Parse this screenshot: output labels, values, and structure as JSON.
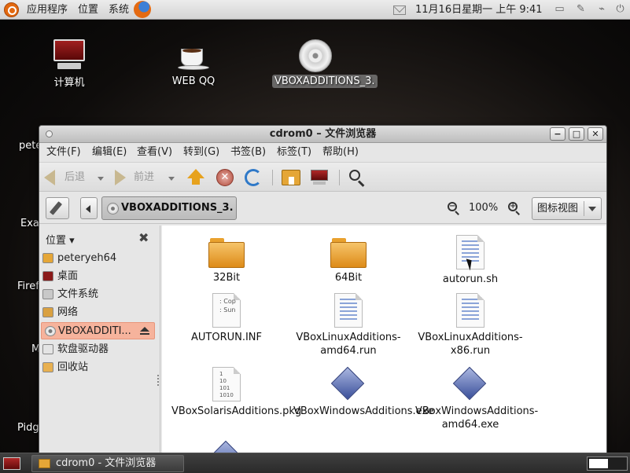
{
  "top_panel": {
    "menus": [
      "应用程序",
      "位置",
      "系统"
    ],
    "clock": "11月16日星期一 上午  9:41",
    "icons": [
      "ubuntu-logo-icon",
      "firefox-icon",
      "mail-icon",
      "network-icon",
      "display-icon",
      "power-icon"
    ]
  },
  "desktop": {
    "icons": [
      {
        "label": "计算机",
        "icon": "computer-icon"
      },
      {
        "label": "WEB QQ",
        "icon": "coffee-cup-icon"
      },
      {
        "label": "VBOXADDITIONS_3.",
        "icon": "disc-icon",
        "selected": true
      }
    ],
    "partial_labels": [
      "pete",
      "Exa",
      "Firef",
      "M",
      "Pidg"
    ]
  },
  "window": {
    "title": "cdrom0 – 文件浏览器",
    "buttons": {
      "minimize": "−",
      "maximize": "□",
      "close": "✕"
    },
    "menus": [
      "文件(F)",
      "编辑(E)",
      "查看(V)",
      "转到(G)",
      "书签(B)",
      "标签(T)",
      "帮助(H)"
    ],
    "toolbar": {
      "back": "后退",
      "forward": "前进"
    },
    "location": {
      "crumb": "VBOXADDITIONS_3.",
      "zoom": "100%",
      "view_mode": "图标视图"
    },
    "sidebar": {
      "header": "位置 ▾",
      "close": "✖",
      "items": [
        {
          "label": "peteryeh64",
          "icon": "home-folder-icon"
        },
        {
          "label": "桌面",
          "icon": "desktop-icon"
        },
        {
          "label": "文件系统",
          "icon": "harddisk-icon"
        },
        {
          "label": "网络",
          "icon": "network-icon"
        },
        {
          "label": "VBOXADDITI...",
          "icon": "disc-icon",
          "selected": true
        },
        {
          "label": "软盘驱动器",
          "icon": "floppy-icon"
        },
        {
          "label": "回收站",
          "icon": "trash-icon"
        }
      ]
    },
    "files": [
      {
        "name": "32Bit",
        "type": "folder"
      },
      {
        "name": "64Bit",
        "type": "folder"
      },
      {
        "name": "autorun.sh",
        "type": "script"
      },
      {
        "name": "AUTORUN.INF",
        "type": "inf",
        "icon_text": ": Cop\n: Sun"
      },
      {
        "name": "VBoxLinuxAdditions-amd64.run",
        "type": "script"
      },
      {
        "name": "VBoxLinuxAdditions-x86.run",
        "type": "script"
      },
      {
        "name": "VBoxSolarisAdditions.pkg",
        "type": "binary",
        "icon_text": "1\n10\n101\n1010"
      },
      {
        "name": "VBoxWindowsAdditions.exe",
        "type": "exe"
      },
      {
        "name": "VBoxWindowsAdditions-amd64.exe",
        "type": "exe"
      }
    ]
  },
  "bottom_panel": {
    "task_label": "cdrom0 - 文件浏览器"
  }
}
